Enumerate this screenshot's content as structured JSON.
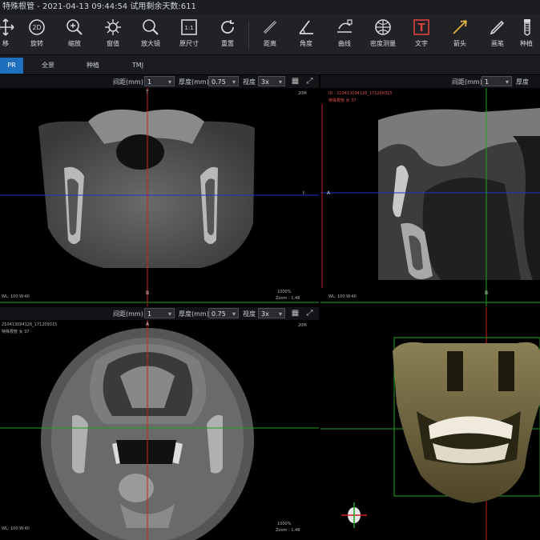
{
  "titlebar": {
    "text": "特殊根管 - 2021-04-13 09:44:54 试用剩余天数:611"
  },
  "toolbar": {
    "items": [
      {
        "label": "移",
        "icon": "move-icon"
      },
      {
        "label": "旋转",
        "icon": "rotate-2d-icon",
        "badge": "2D"
      },
      {
        "label": "缩放",
        "icon": "zoom-icon"
      },
      {
        "label": "窗值",
        "icon": "window-level-icon"
      },
      {
        "label": "放大镜",
        "icon": "magnifier-icon"
      },
      {
        "label": "原尺寸",
        "icon": "original-size-icon",
        "badge": "1:1"
      },
      {
        "label": "重置",
        "icon": "reset-icon"
      },
      {
        "label": "距离",
        "icon": "distance-icon"
      },
      {
        "label": "角度",
        "icon": "angle-icon"
      },
      {
        "label": "曲线",
        "icon": "curve-icon"
      },
      {
        "label": "密度测量",
        "icon": "density-icon"
      },
      {
        "label": "文字",
        "icon": "text-icon",
        "badge": "T"
      },
      {
        "label": "箭头",
        "icon": "arrow-icon"
      },
      {
        "label": "画笔",
        "icon": "pen-icon"
      },
      {
        "label": "种植",
        "icon": "implant-icon"
      }
    ]
  },
  "tabs": [
    {
      "label": "PR",
      "active": true
    },
    {
      "label": "全景",
      "active": false
    },
    {
      "label": "种植",
      "active": false
    },
    {
      "label": "TMJ",
      "active": false
    }
  ],
  "views": {
    "coronal": {
      "spacing_label": "间距(mm)",
      "spacing_value": "1",
      "thickness_label": "厚度(mm)",
      "thickness_value": "0.75",
      "zoom_label": "视度",
      "zoom_value": "3x",
      "top_marker": "T",
      "bottom_marker": "B",
      "right_marker": "I",
      "scale_text": "20M",
      "bottom_left": "WL: 100 W:40",
      "bottom_right_1": "1000%",
      "bottom_right_2": "Zoom : 1.46"
    },
    "sagittal": {
      "spacing_label": "间距(mm)",
      "spacing_value": "1",
      "thickness_label": "厚度",
      "left_marker": "A",
      "bottom_marker": "B",
      "info_1": "ID : 210413094126_171209315",
      "info_2": "特殊根管 女 37",
      "bottom_left": "WL: 100 W:40"
    },
    "axial": {
      "spacing_label": "间距(mm)",
      "spacing_value": "1",
      "thickness_label": "厚度(mm)",
      "thickness_value": "0.75",
      "zoom_label": "视度",
      "zoom_value": "3x",
      "top_marker": "A",
      "info_1": "210413094126_171209315",
      "info_2": "特殊根管 女 37",
      "scale_text": "20M",
      "bottom_left": "WL: 100 W:40",
      "bottom_right_1": "1000%",
      "bottom_right_2": "Zoom : 1.46"
    },
    "volume3d": {}
  },
  "colors": {
    "accent": "#1f6fbf",
    "crosshair_red": "#d02020",
    "crosshair_blue": "#2030d0",
    "crosshair_green": "#20a020"
  }
}
